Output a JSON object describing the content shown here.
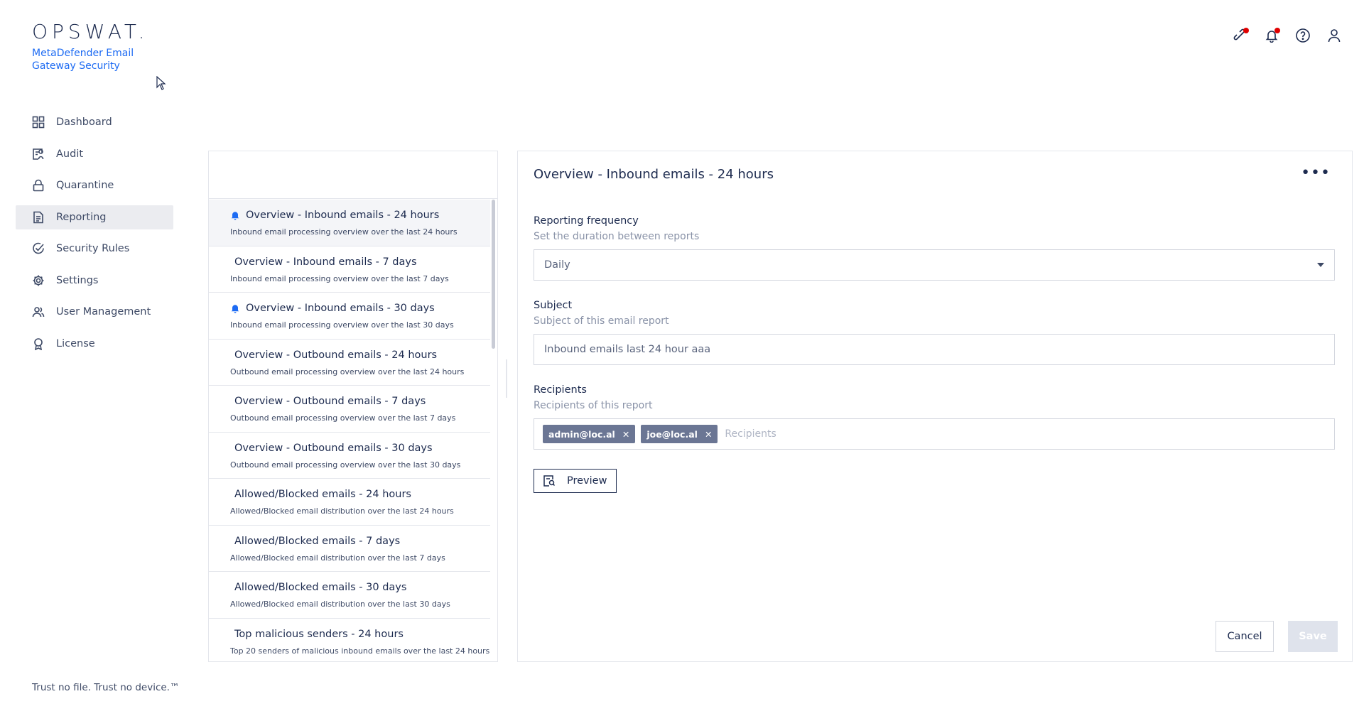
{
  "brand": {
    "logo_text": "OPSWAT.",
    "product_name": "MetaDefender Email Gateway Security",
    "tagline": "Trust no file. Trust no device.™"
  },
  "colors": {
    "accent": "#1d6bf3",
    "text": "#1d2b4f",
    "notification_dot": "#e00000",
    "chip_bg": "#6b7694"
  },
  "sidebar": {
    "items": [
      {
        "label": "Dashboard",
        "icon": "grid-icon",
        "active": false
      },
      {
        "label": "Audit",
        "icon": "audit-icon",
        "active": false
      },
      {
        "label": "Quarantine",
        "icon": "lock-icon",
        "active": false
      },
      {
        "label": "Reporting",
        "icon": "document-icon",
        "active": true
      },
      {
        "label": "Security Rules",
        "icon": "shield-check-icon",
        "active": false
      },
      {
        "label": "Settings",
        "icon": "gear-icon",
        "active": false
      },
      {
        "label": "User Management",
        "icon": "users-icon",
        "active": false
      },
      {
        "label": "License",
        "icon": "award-icon",
        "active": false
      }
    ]
  },
  "topbar": {
    "icons": [
      "integration-icon",
      "bell-icon",
      "help-icon",
      "user-icon"
    ]
  },
  "reports": [
    {
      "title": "Overview - Inbound emails - 24 hours",
      "desc": "Inbound email processing overview over the last 24 hours",
      "subscribed": true,
      "selected": true
    },
    {
      "title": "Overview - Inbound emails - 7 days",
      "desc": "Inbound email processing overview over the last 7 days",
      "subscribed": false,
      "selected": false
    },
    {
      "title": "Overview - Inbound emails - 30 days",
      "desc": "Inbound email processing overview over the last 30 days",
      "subscribed": true,
      "selected": false
    },
    {
      "title": "Overview - Outbound emails - 24 hours",
      "desc": "Outbound email processing overview over the last 24 hours",
      "subscribed": false,
      "selected": false
    },
    {
      "title": "Overview - Outbound emails - 7 days",
      "desc": "Outbound email processing overview over the last 7 days",
      "subscribed": false,
      "selected": false
    },
    {
      "title": "Overview - Outbound emails - 30 days",
      "desc": "Outbound email processing overview over the last 30 days",
      "subscribed": false,
      "selected": false
    },
    {
      "title": "Allowed/Blocked emails - 24 hours",
      "desc": "Allowed/Blocked email distribution over the last 24 hours",
      "subscribed": false,
      "selected": false
    },
    {
      "title": "Allowed/Blocked emails - 7 days",
      "desc": "Allowed/Blocked email distribution over the last 7 days",
      "subscribed": false,
      "selected": false
    },
    {
      "title": "Allowed/Blocked emails - 30 days",
      "desc": "Allowed/Blocked email distribution over the last 30 days",
      "subscribed": false,
      "selected": false
    },
    {
      "title": "Top malicious senders - 24 hours",
      "desc": "Top 20 senders of malicious inbound emails over the last 24 hours",
      "subscribed": false,
      "selected": false
    }
  ],
  "detail": {
    "title": "Overview - Inbound emails - 24 hours",
    "more_label": "•••",
    "frequency": {
      "label": "Reporting frequency",
      "help": "Set the duration between reports",
      "value": "Daily"
    },
    "subject": {
      "label": "Subject",
      "help": "Subject of this email report",
      "value": "Inbound emails last 24 hour aaa"
    },
    "recipients": {
      "label": "Recipients",
      "help": "Recipients of this report",
      "chips": [
        "admin@loc.al",
        "joe@loc.al"
      ],
      "placeholder": "Recipients"
    },
    "preview_label": "Preview",
    "cancel_label": "Cancel",
    "save_label": "Save"
  }
}
